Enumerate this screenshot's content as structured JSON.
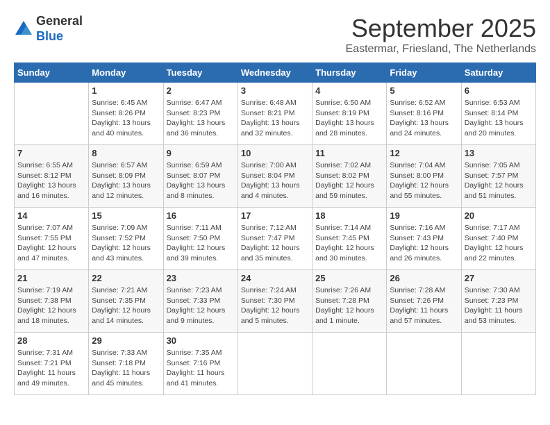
{
  "header": {
    "logo_line1": "General",
    "logo_line2": "Blue",
    "month": "September 2025",
    "location": "Eastermar, Friesland, The Netherlands"
  },
  "weekdays": [
    "Sunday",
    "Monday",
    "Tuesday",
    "Wednesday",
    "Thursday",
    "Friday",
    "Saturday"
  ],
  "weeks": [
    [
      {
        "day": "",
        "info": ""
      },
      {
        "day": "1",
        "info": "Sunrise: 6:45 AM\nSunset: 8:26 PM\nDaylight: 13 hours\nand 40 minutes."
      },
      {
        "day": "2",
        "info": "Sunrise: 6:47 AM\nSunset: 8:23 PM\nDaylight: 13 hours\nand 36 minutes."
      },
      {
        "day": "3",
        "info": "Sunrise: 6:48 AM\nSunset: 8:21 PM\nDaylight: 13 hours\nand 32 minutes."
      },
      {
        "day": "4",
        "info": "Sunrise: 6:50 AM\nSunset: 8:19 PM\nDaylight: 13 hours\nand 28 minutes."
      },
      {
        "day": "5",
        "info": "Sunrise: 6:52 AM\nSunset: 8:16 PM\nDaylight: 13 hours\nand 24 minutes."
      },
      {
        "day": "6",
        "info": "Sunrise: 6:53 AM\nSunset: 8:14 PM\nDaylight: 13 hours\nand 20 minutes."
      }
    ],
    [
      {
        "day": "7",
        "info": "Sunrise: 6:55 AM\nSunset: 8:12 PM\nDaylight: 13 hours\nand 16 minutes."
      },
      {
        "day": "8",
        "info": "Sunrise: 6:57 AM\nSunset: 8:09 PM\nDaylight: 13 hours\nand 12 minutes."
      },
      {
        "day": "9",
        "info": "Sunrise: 6:59 AM\nSunset: 8:07 PM\nDaylight: 13 hours\nand 8 minutes."
      },
      {
        "day": "10",
        "info": "Sunrise: 7:00 AM\nSunset: 8:04 PM\nDaylight: 13 hours\nand 4 minutes."
      },
      {
        "day": "11",
        "info": "Sunrise: 7:02 AM\nSunset: 8:02 PM\nDaylight: 12 hours\nand 59 minutes."
      },
      {
        "day": "12",
        "info": "Sunrise: 7:04 AM\nSunset: 8:00 PM\nDaylight: 12 hours\nand 55 minutes."
      },
      {
        "day": "13",
        "info": "Sunrise: 7:05 AM\nSunset: 7:57 PM\nDaylight: 12 hours\nand 51 minutes."
      }
    ],
    [
      {
        "day": "14",
        "info": "Sunrise: 7:07 AM\nSunset: 7:55 PM\nDaylight: 12 hours\nand 47 minutes."
      },
      {
        "day": "15",
        "info": "Sunrise: 7:09 AM\nSunset: 7:52 PM\nDaylight: 12 hours\nand 43 minutes."
      },
      {
        "day": "16",
        "info": "Sunrise: 7:11 AM\nSunset: 7:50 PM\nDaylight: 12 hours\nand 39 minutes."
      },
      {
        "day": "17",
        "info": "Sunrise: 7:12 AM\nSunset: 7:47 PM\nDaylight: 12 hours\nand 35 minutes."
      },
      {
        "day": "18",
        "info": "Sunrise: 7:14 AM\nSunset: 7:45 PM\nDaylight: 12 hours\nand 30 minutes."
      },
      {
        "day": "19",
        "info": "Sunrise: 7:16 AM\nSunset: 7:43 PM\nDaylight: 12 hours\nand 26 minutes."
      },
      {
        "day": "20",
        "info": "Sunrise: 7:17 AM\nSunset: 7:40 PM\nDaylight: 12 hours\nand 22 minutes."
      }
    ],
    [
      {
        "day": "21",
        "info": "Sunrise: 7:19 AM\nSunset: 7:38 PM\nDaylight: 12 hours\nand 18 minutes."
      },
      {
        "day": "22",
        "info": "Sunrise: 7:21 AM\nSunset: 7:35 PM\nDaylight: 12 hours\nand 14 minutes."
      },
      {
        "day": "23",
        "info": "Sunrise: 7:23 AM\nSunset: 7:33 PM\nDaylight: 12 hours\nand 9 minutes."
      },
      {
        "day": "24",
        "info": "Sunrise: 7:24 AM\nSunset: 7:30 PM\nDaylight: 12 hours\nand 5 minutes."
      },
      {
        "day": "25",
        "info": "Sunrise: 7:26 AM\nSunset: 7:28 PM\nDaylight: 12 hours\nand 1 minute."
      },
      {
        "day": "26",
        "info": "Sunrise: 7:28 AM\nSunset: 7:26 PM\nDaylight: 11 hours\nand 57 minutes."
      },
      {
        "day": "27",
        "info": "Sunrise: 7:30 AM\nSunset: 7:23 PM\nDaylight: 11 hours\nand 53 minutes."
      }
    ],
    [
      {
        "day": "28",
        "info": "Sunrise: 7:31 AM\nSunset: 7:21 PM\nDaylight: 11 hours\nand 49 minutes."
      },
      {
        "day": "29",
        "info": "Sunrise: 7:33 AM\nSunset: 7:18 PM\nDaylight: 11 hours\nand 45 minutes."
      },
      {
        "day": "30",
        "info": "Sunrise: 7:35 AM\nSunset: 7:16 PM\nDaylight: 11 hours\nand 41 minutes."
      },
      {
        "day": "",
        "info": ""
      },
      {
        "day": "",
        "info": ""
      },
      {
        "day": "",
        "info": ""
      },
      {
        "day": "",
        "info": ""
      }
    ]
  ]
}
